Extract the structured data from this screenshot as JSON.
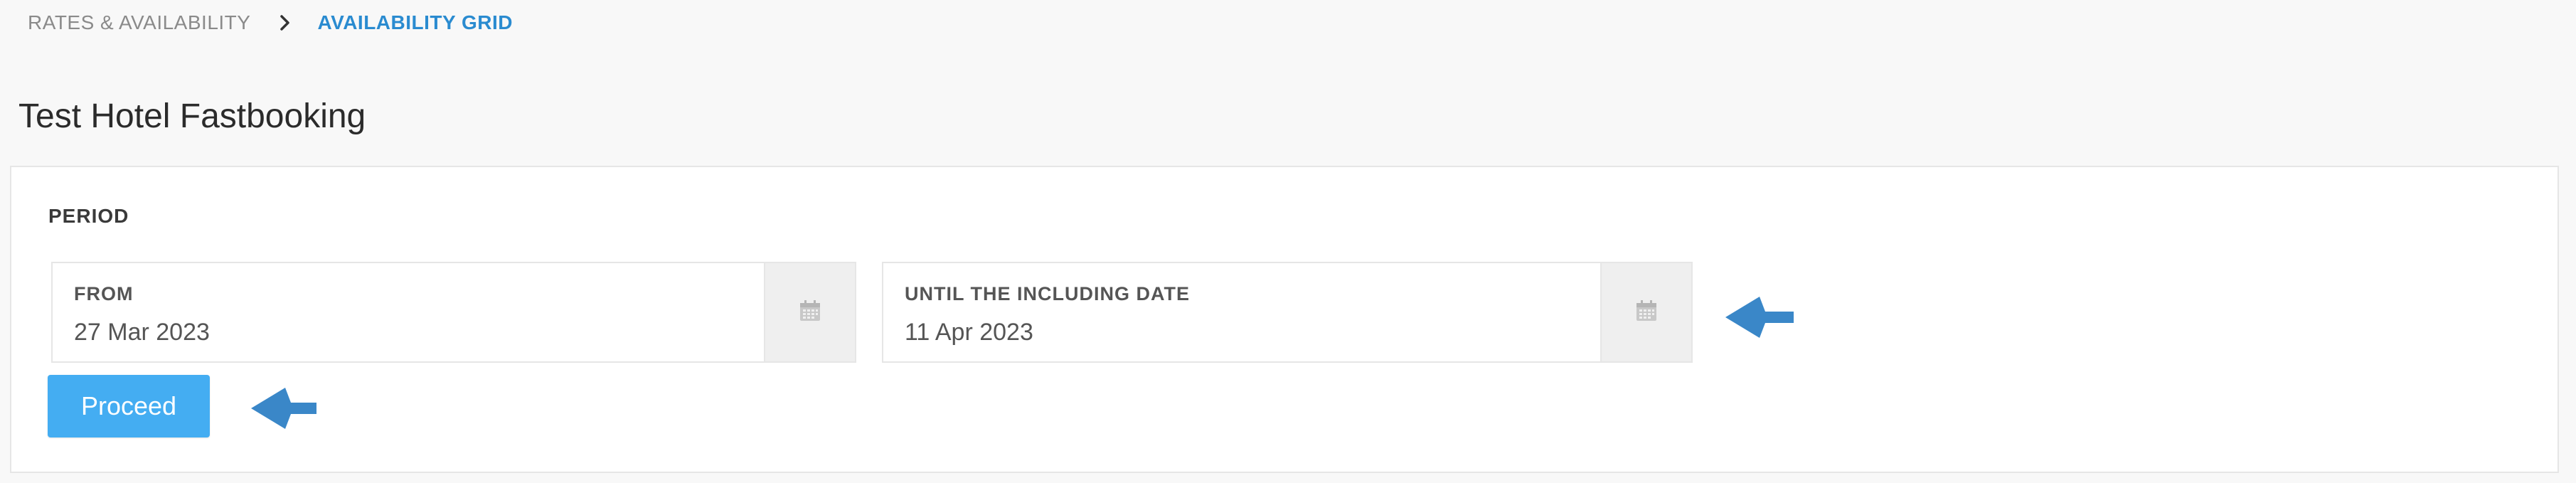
{
  "breadcrumb": {
    "parent": "RATES & AVAILABILITY",
    "current": "AVAILABILITY GRID",
    "separator_icon": "chevron-right-icon"
  },
  "page": {
    "title": "Test Hotel Fastbooking"
  },
  "period": {
    "label": "PERIOD",
    "from": {
      "label": "FROM",
      "value": "27 Mar 2023",
      "icon": "calendar-icon"
    },
    "until": {
      "label": "UNTIL THE INCLUDING DATE",
      "value": "11 Apr 2023",
      "icon": "calendar-icon"
    }
  },
  "actions": {
    "proceed_label": "Proceed"
  },
  "annotations": {
    "arrow_color": "#3a87c8",
    "icon": "arrow-left-icon"
  },
  "colors": {
    "accent": "#2a8bd0",
    "button": "#44adf2"
  }
}
